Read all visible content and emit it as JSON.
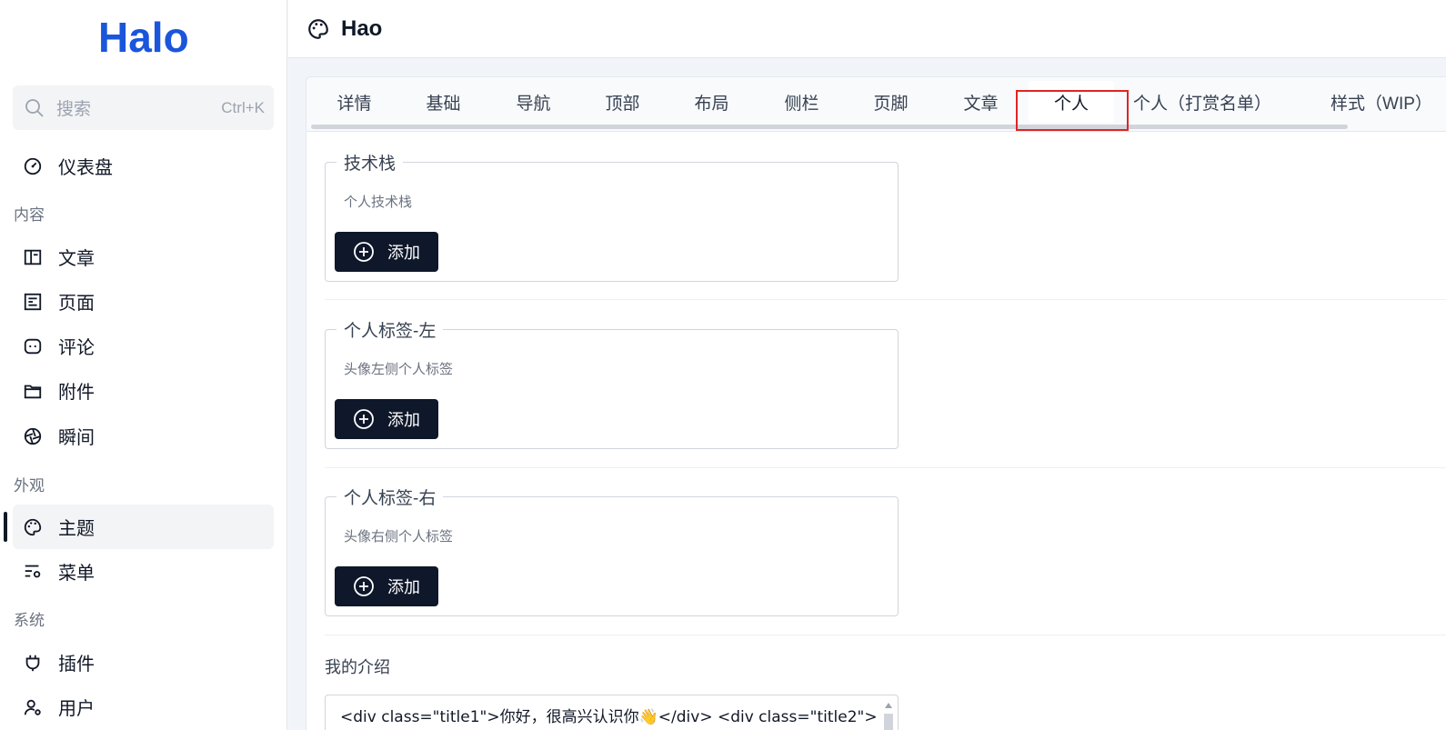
{
  "app": {
    "logo_text": "Halo",
    "brand_color": "#1a56db"
  },
  "search": {
    "label": "搜索",
    "shortcut": "Ctrl+K"
  },
  "sidebar": {
    "dashboard": "仪表盘",
    "groups": {
      "content": "内容",
      "appearance": "外观",
      "system": "系统"
    },
    "items": {
      "posts": "文章",
      "pages": "页面",
      "comments": "评论",
      "attachments": "附件",
      "moments": "瞬间",
      "themes": "主题",
      "menus": "菜单",
      "plugins": "插件",
      "users": "用户"
    },
    "active": "themes"
  },
  "header": {
    "title": "Hao"
  },
  "tabs": [
    "详情",
    "基础",
    "导航",
    "顶部",
    "布局",
    "侧栏",
    "页脚",
    "文章",
    "个人",
    "个人（打赏名单）",
    "样式（WIP）"
  ],
  "active_tab": "个人",
  "form": {
    "tech_stack": {
      "legend": "技术栈",
      "help": "个人技术栈",
      "button": "添加"
    },
    "tags_left": {
      "legend": "个人标签-左",
      "help": "头像左侧个人标签",
      "button": "添加"
    },
    "tags_right": {
      "legend": "个人标签-右",
      "help": "头像右侧个人标签",
      "button": "添加"
    },
    "intro": {
      "label": "我的介绍",
      "value": "<div class=\"title1\">你好，很高兴认识你👋</div> <div class=\"title2\">"
    }
  },
  "colors": {
    "button_bg": "#0f172a",
    "highlight": "#e02424"
  }
}
